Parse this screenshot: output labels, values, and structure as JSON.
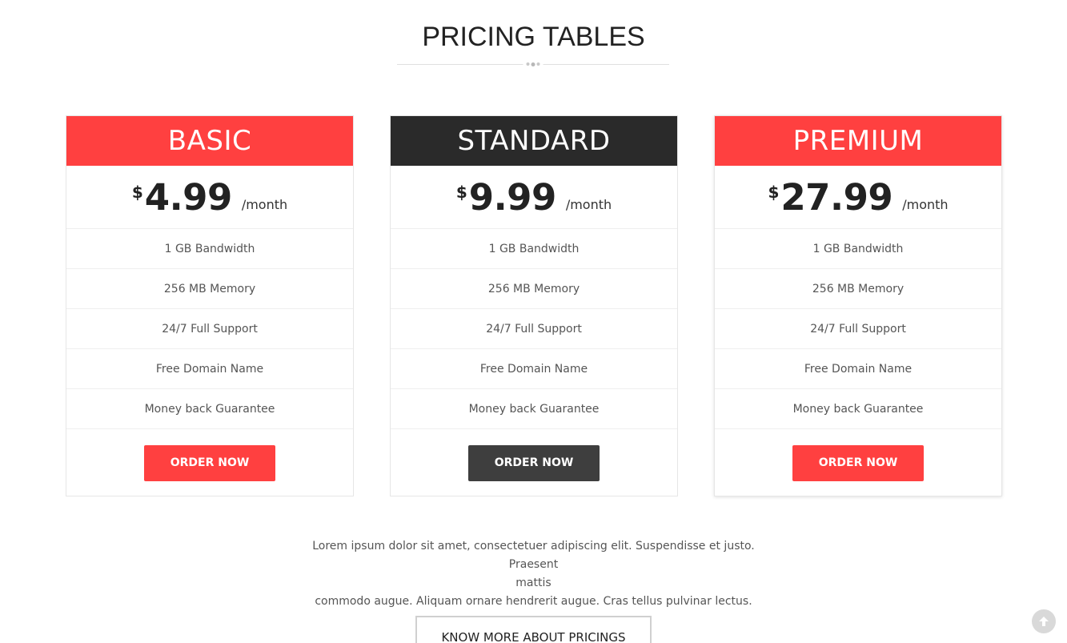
{
  "section": {
    "title": "PRICING TABLES"
  },
  "colors": {
    "accent": "#ff4040",
    "dark": "#2a2a2a",
    "dark_button": "#3e3e3e"
  },
  "plans": [
    {
      "name": "BASIC",
      "currency": "$",
      "amount": "4.99",
      "period": "/month",
      "features": [
        "1 GB Bandwidth",
        "256 MB Memory",
        "24/7 Full Support",
        "Free Domain Name",
        "Money back Guarantee"
      ],
      "button_label": "ORDER NOW"
    },
    {
      "name": "STANDARD",
      "currency": "$",
      "amount": "9.99",
      "period": "/month",
      "features": [
        "1 GB Bandwidth",
        "256 MB Memory",
        "24/7 Full Support",
        "Free Domain Name",
        "Money back Guarantee"
      ],
      "button_label": "ORDER NOW"
    },
    {
      "name": "PREMIUM",
      "currency": "$",
      "amount": "27.99",
      "period": "/month",
      "features": [
        "1 GB Bandwidth",
        "256 MB Memory",
        "24/7 Full Support",
        "Free Domain Name",
        "Money back Guarantee"
      ],
      "button_label": "ORDER NOW"
    }
  ],
  "description": {
    "line1": "Lorem ipsum dolor sit amet, consectetuer adipiscing elit. Suspendisse et justo. Praesent",
    "line2": "mattis",
    "line3": "commodo augue. Aliquam ornare hendrerit augue. Cras tellus pulvinar lectus."
  },
  "know_more_label": "KNOW MORE ABOUT PRICINGS",
  "icons": {
    "scroll_top": "arrow-up-circle-icon"
  }
}
